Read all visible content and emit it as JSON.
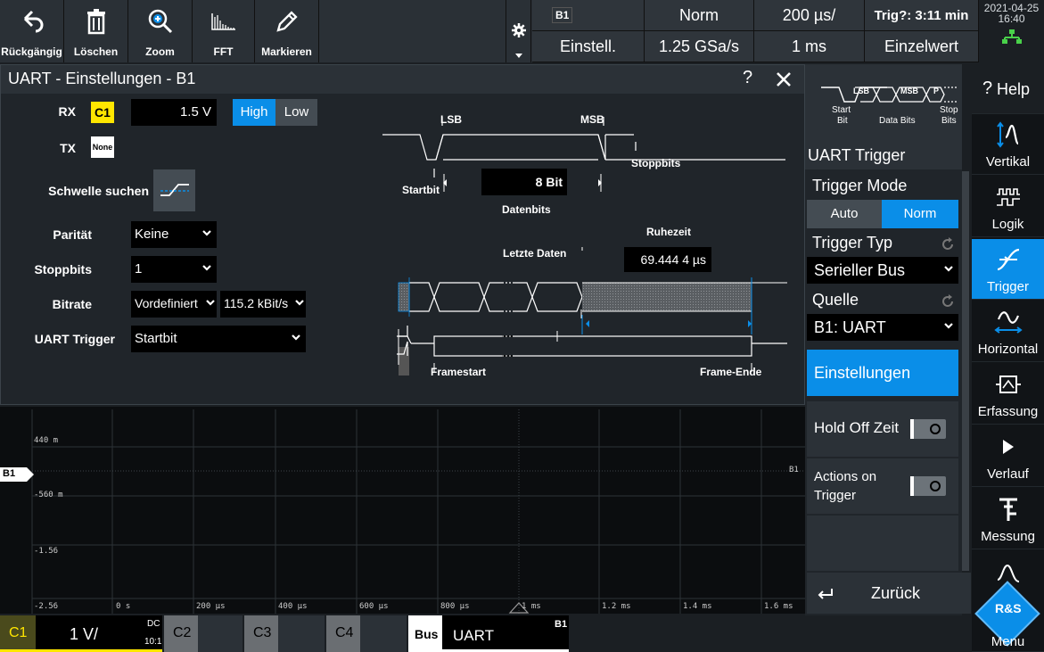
{
  "toolbar": {
    "buttons": [
      {
        "label": "Rückgängig",
        "icon": "undo-icon"
      },
      {
        "label": "Löschen",
        "icon": "trash-icon"
      },
      {
        "label": "Zoom",
        "icon": "zoom-icon"
      },
      {
        "label": "FFT",
        "icon": "fft-icon"
      },
      {
        "label": "Markieren",
        "icon": "pencil-icon"
      }
    ],
    "status": {
      "bus_badge": "B1",
      "mode": "Norm",
      "timebase": "200 µs/",
      "trig": "Trig?: 3:11 min",
      "settings": "Einstell.",
      "sample_rate": "1.25 GSa/s",
      "record": "1 ms",
      "acq": "Einzelwert"
    },
    "date": "2021-04-25",
    "time": "16:40"
  },
  "dialog": {
    "title": "UART - Einstellungen - B1",
    "help": "?",
    "rx_label": "RX",
    "rx_channel": "C1",
    "rx_threshold": "1.5 V",
    "polarity_high": "High",
    "polarity_low": "Low",
    "tx_label": "TX",
    "tx_channel": "None",
    "threshold_search": "Schwelle suchen",
    "parity_label": "Parität",
    "parity_value": "Keine",
    "stopbits_label": "Stoppbits",
    "stopbits_value": "1",
    "bitrate_label": "Bitrate",
    "bitrate_mode": "Vordefiniert",
    "bitrate_value": "115.2 kBit/s",
    "uart_trigger_label": "UART Trigger",
    "uart_trigger_value": "Startbit",
    "diagram": {
      "lsb": "LSB",
      "msb": "MSB",
      "stoppbits": "Stoppbits",
      "startbit": "Startbit",
      "databits_value": "8 Bit",
      "databits": "Datenbits",
      "idle": "Ruhezeit",
      "last_data": "Letzte Daten",
      "idle_value": "69.444 4 µs",
      "framestart": "Framestart",
      "frame_end": "Frame-Ende"
    }
  },
  "panel": {
    "diagram": {
      "lsb": "LSB",
      "msb": "MSB",
      "p": "P",
      "start": "Start",
      "bit": "Bit",
      "data_bits": "Data Bits",
      "stop": "Stop",
      "bits": "Bits"
    },
    "title": "UART Trigger",
    "trigger_mode_label": "Trigger Mode",
    "mode_auto": "Auto",
    "mode_norm": "Norm",
    "trigger_type_label": "Trigger Typ",
    "trigger_type_value": "Serieller Bus",
    "source_label": "Quelle",
    "source_value": "B1: UART",
    "settings_button": "Einstellungen",
    "holdoff_label": "Hold Off Zeit",
    "actions_label_1": "Actions on",
    "actions_label_2": "Trigger",
    "back_button": "Zurück"
  },
  "sidebar": {
    "items": [
      {
        "label": "Help",
        "icon": "help-icon"
      },
      {
        "label": "Vertikal",
        "icon": "vertical-icon"
      },
      {
        "label": "Logik",
        "icon": "logic-icon"
      },
      {
        "label": "Trigger",
        "icon": "trigger-icon"
      },
      {
        "label": "Horizontal",
        "icon": "horizontal-icon"
      },
      {
        "label": "Erfassung",
        "icon": "acquisition-icon"
      },
      {
        "label": "Verlauf",
        "icon": "play-icon"
      },
      {
        "label": "Messung",
        "icon": "measure-icon"
      },
      {
        "label": "Menu",
        "icon": "rs-logo-icon"
      }
    ]
  },
  "waveform": {
    "bus_marker": "B1",
    "right_label": "B1",
    "y_labels": [
      "440 m",
      "-560 m",
      "-1.56",
      "-2.56"
    ],
    "x_labels": [
      "0 s",
      "200 µs",
      "400 µs",
      "600 µs",
      "800 µs",
      "1 ms",
      "1.2 ms",
      "1.4 ms",
      "1.6 ms"
    ]
  },
  "bottom": {
    "c1": "C1",
    "c1_scale": "1 V/",
    "c1_coupling": "DC",
    "c1_probe": "10:1",
    "c2": "C2",
    "c3": "C3",
    "c4": "C4",
    "bus_label": "Bus",
    "bus_name": "UART",
    "bus_id": "B1"
  },
  "colors": {
    "accent_blue": "#0a8ee8",
    "channel_yellow": "#ffe600",
    "c1_bg": "#4a4a1c"
  }
}
